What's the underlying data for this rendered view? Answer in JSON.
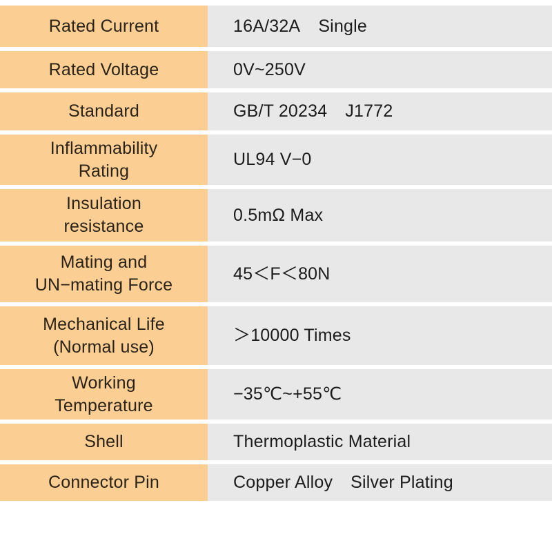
{
  "table": {
    "title": "Connector Specification Table",
    "column_count": 2,
    "row_count": 10,
    "colors": {
      "label_cell_background": "#FBCF94",
      "value_cell_background": "#E8E8E9",
      "separator": "#FFFFFF",
      "label_text": "#2B2218",
      "value_text": "#1C1C1C",
      "page_background": "#FFFFFF"
    },
    "rows": [
      {
        "label": "Rated Current",
        "label_lines": [
          "Rated Current"
        ],
        "value": "16A/32A   Single",
        "value_parts": [
          "16A/32A",
          "Single"
        ]
      },
      {
        "label": "Rated Voltage",
        "label_lines": [
          "Rated Voltage"
        ],
        "value": "0V~250V",
        "value_parts": [
          "0V~250V"
        ]
      },
      {
        "label": "Standard",
        "label_lines": [
          "Standard"
        ],
        "value": "GB/T 20234   J1772",
        "value_parts": [
          "GB/T 20234",
          "J1772"
        ]
      },
      {
        "label": "Inflammability Rating",
        "label_lines": [
          "Inflammability",
          "Rating"
        ],
        "value": "UL94 V-0",
        "value_parts": [
          "UL94 V−0"
        ]
      },
      {
        "label": "Insulation resistance",
        "label_lines": [
          "Insulation",
          "resistance"
        ],
        "value": "0.5mΩ Max",
        "value_parts": [
          "0.5mΩ Max"
        ]
      },
      {
        "label": "Mating and UN-mating Force",
        "label_lines": [
          "Mating and",
          "UN−mating Force"
        ],
        "value": "45<F<80N",
        "value_parts": [
          "45＜F＜80N"
        ]
      },
      {
        "label": "Mechanical Life (Normal use)",
        "label_lines": [
          "Mechanical Life",
          "(Normal use)"
        ],
        "value": ">10000 Times",
        "value_parts": [
          "＞10000 Times"
        ]
      },
      {
        "label": "Working Temperature",
        "label_lines": [
          "Working",
          "Temperature"
        ],
        "value": "-35℃~+55℃",
        "value_parts": [
          "−35℃~+55℃"
        ]
      },
      {
        "label": "Shell",
        "label_lines": [
          "Shell"
        ],
        "value": "Thermoplastic Material",
        "value_parts": [
          "Thermoplastic Material"
        ]
      },
      {
        "label": "Connector Pin",
        "label_lines": [
          "Connector Pin"
        ],
        "value": "Copper Alloy   Silver Plating",
        "value_parts": [
          "Copper Alloy",
          "Silver Plating"
        ]
      }
    ]
  }
}
